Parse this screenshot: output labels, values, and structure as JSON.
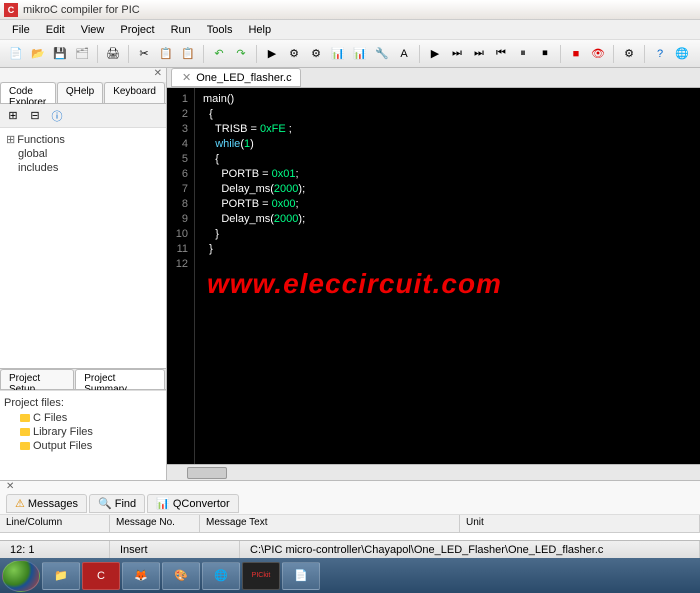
{
  "titlebar": {
    "icon": "C",
    "text": "mikroC compiler for PIC"
  },
  "menu": {
    "file": "File",
    "edit": "Edit",
    "view": "View",
    "project": "Project",
    "run": "Run",
    "tools": "Tools",
    "help": "Help"
  },
  "left": {
    "tabs": {
      "explorer": "Code Explorer",
      "qhelp": "QHelp",
      "keyboard": "Keyboard"
    },
    "tree": {
      "root": "Functions",
      "global": "global",
      "includes": "includes"
    },
    "bottom_tabs": {
      "setup": "Project Setup",
      "summary": "Project Summary"
    },
    "project_files_label": "Project files:",
    "files": {
      "c": "C Files",
      "lib": "Library Files",
      "out": "Output Files"
    }
  },
  "editor": {
    "tab_name": "One_LED_flasher.c",
    "lines": [
      "main()",
      "  {",
      "    TRISB = 0xFE ;",
      "    while(1)",
      "    {",
      "      PORTB = 0x01;",
      "      Delay_ms(2000);",
      "      PORTB = 0x00;",
      "      Delay_ms(2000);",
      "    }",
      "  }",
      ""
    ]
  },
  "watermark": "www.eleccircuit.com",
  "messages": {
    "tabs": {
      "messages": "Messages",
      "find": "Find",
      "qconv": "QConvertor"
    },
    "cols": {
      "line": "Line/Column",
      "no": "Message No.",
      "text": "Message Text",
      "unit": "Unit"
    }
  },
  "status": {
    "line": "12: 1",
    "mode": "Insert",
    "path": "C:\\PIC micro-controller\\Chayapol\\One_LED_Flasher\\One_LED_flasher.c"
  }
}
